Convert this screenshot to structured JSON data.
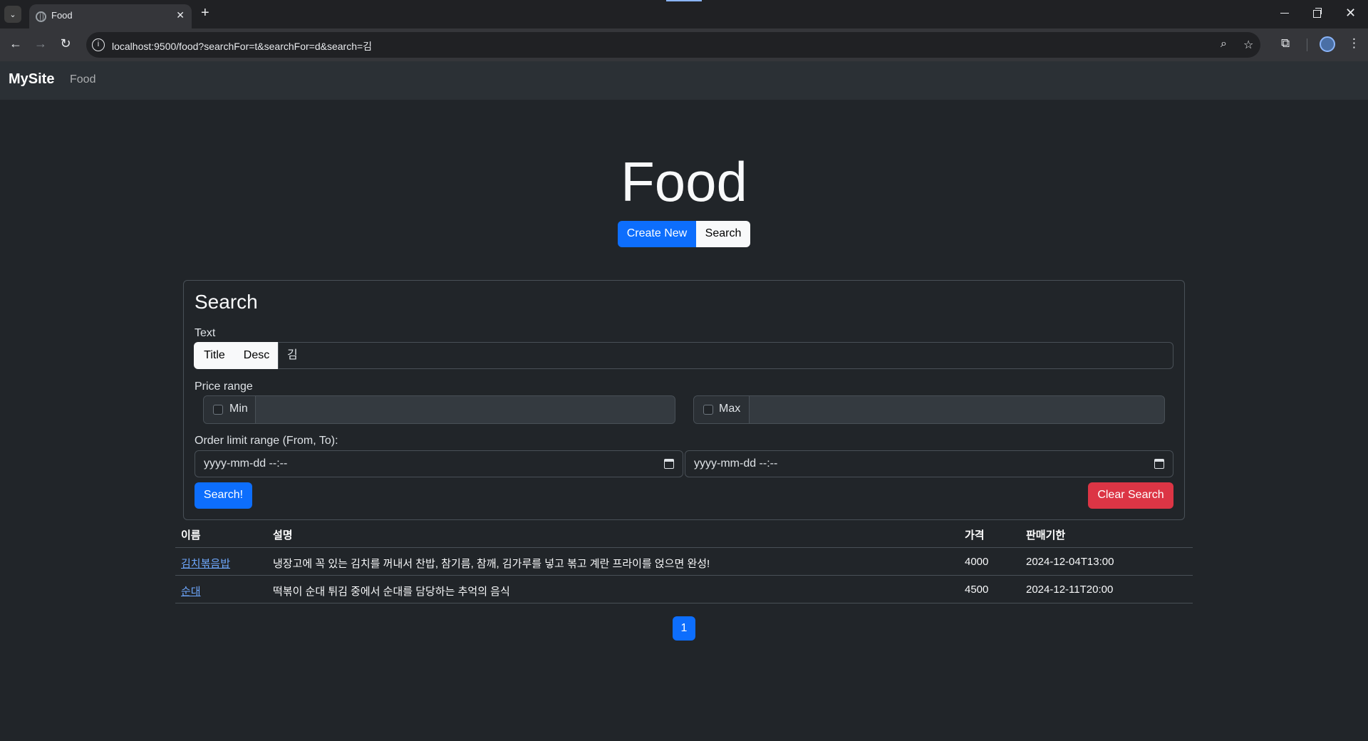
{
  "browser": {
    "tab_title": "Food",
    "url": "localhost:9500/food?searchFor=t&searchFor=d&search=김",
    "new_tab": "+",
    "tab_close": "✕",
    "back": "←",
    "forward": "→",
    "reload": "↻",
    "site_info": "i",
    "zoom_icon": "⌕",
    "star_icon": "☆",
    "extensions_icon": "⧉",
    "menu_icon": "⋮",
    "tab_menu": "⌄",
    "window_close": "✕"
  },
  "navbar": {
    "brand": "MySite",
    "links": [
      "Food"
    ]
  },
  "header": {
    "title": "Food",
    "create_new": "Create New",
    "search": "Search"
  },
  "search_card": {
    "title": "Search",
    "text_label": "Text",
    "toggle_title": "Title",
    "toggle_desc": "Desc",
    "text_value": "김",
    "price_label": "Price range",
    "min_label": "Min",
    "max_label": "Max",
    "min_checked": false,
    "max_checked": false,
    "min_value": "",
    "max_value": "",
    "order_label": "Order limit range (From, To):",
    "from_placeholder": "yyyy-mm-dd --:--",
    "to_placeholder": "yyyy-mm-dd --:--",
    "search_button": "Search!",
    "clear_button": "Clear Search"
  },
  "table": {
    "headers": [
      "이름",
      "설명",
      "가격",
      "판매기한"
    ],
    "rows": [
      {
        "name": "김치볶음밥",
        "desc": "냉장고에 꼭 있는 김치를 꺼내서 찬밥, 참기름, 참깨, 김가루를 넣고 볶고 계란 프라이를 얹으면 완성!",
        "price": "4000",
        "deadline": "2024-12-04T13:00"
      },
      {
        "name": "순대",
        "desc": "떡볶이 순대 튀김 중에서 순대를 담당하는 추억의 음식",
        "price": "4500",
        "deadline": "2024-12-11T20:00"
      }
    ]
  },
  "pagination": {
    "current": "1"
  },
  "colors": {
    "primary": "#0d6efd",
    "danger": "#dc3545",
    "background": "#212529",
    "link": "#6ea8fe"
  }
}
